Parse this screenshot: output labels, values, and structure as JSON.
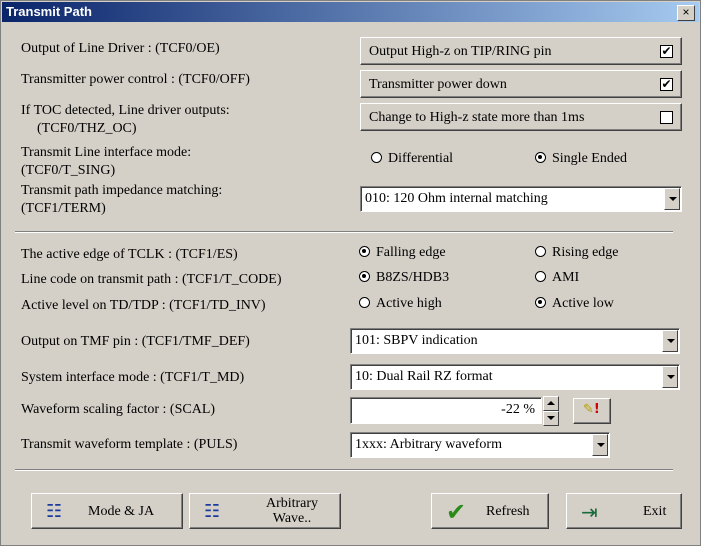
{
  "window": {
    "title": "Transmit Path",
    "close": "×"
  },
  "rows": {
    "output_line_driver": "Output of Line Driver : (TCF0/OE)",
    "tx_power_control": "Transmitter power control : (TCF0/OFF)",
    "toc_line1": "If TOC detected, Line driver outputs:",
    "toc_line2": "(TCF0/THZ_OC)",
    "tx_line_mode_line1": "Transmit Line interface mode:",
    "tx_line_mode_line2": "(TCF0/T_SING)",
    "impedance_line1": "Transmit path impedance matching:",
    "impedance_line2": "(TCF1/TERM)",
    "active_edge": "The active edge of TCLK :  (TCF1/ES)",
    "line_code": "Line code on transmit path : (TCF1/T_CODE)",
    "active_level": "Active level on TD/TDP : (TCF1/TD_INV)",
    "output_tmf": "Output on TMF pin : (TCF1/TMF_DEF)",
    "sys_interface": "System interface mode : (TCF1/T_MD)",
    "waveform_scaling": "Waveform scaling factor : (SCAL)",
    "waveform_template": "Transmit waveform template : (PULS)"
  },
  "option_buttons": {
    "output_highz": {
      "label": "Output High-z on  TIP/RING pin",
      "checked": true,
      "mark": "✔"
    },
    "tx_power_down": {
      "label": "Transmitter power down",
      "checked": true,
      "mark": "✔"
    },
    "change_highz": {
      "label": "Change to High-z state more than 1ms",
      "checked": false,
      "mark": ""
    }
  },
  "radios": {
    "differential": "Differential",
    "single_ended": "Single Ended",
    "falling_edge": "Falling edge",
    "rising_edge": "Rising edge",
    "b8zs": "B8ZS/HDB3",
    "ami": "AMI",
    "active_high": "Active high",
    "active_low": "Active low",
    "selected": {
      "line_mode": "Single Ended",
      "edge": "Falling edge",
      "code": "B8ZS/HDB3",
      "level": "Active low"
    }
  },
  "combos": {
    "impedance": "010: 120 Ohm internal matching",
    "tmf": "101: SBPV indication",
    "sys_mode": "10: Dual Rail RZ format",
    "template": "1xxx:  Arbitrary waveform"
  },
  "scaling": {
    "value": "-22 %"
  },
  "buttons": {
    "mode_ja": "Mode & JA",
    "arb_line1": "Arbitrary",
    "arb_line2": "Wave..",
    "refresh": "Refresh",
    "exit": "Exit"
  },
  "icons": {
    "mode_ja": "network-icon",
    "arbitrary": "network-icon",
    "refresh": "checkmark-icon",
    "exit": "exit-door-icon",
    "edit": "edit-warning-icon"
  },
  "colors": {
    "title_start": "#0a246a",
    "title_end": "#a6caf0",
    "face": "#d4d0c8",
    "refresh_check": "#2a8a1a"
  }
}
